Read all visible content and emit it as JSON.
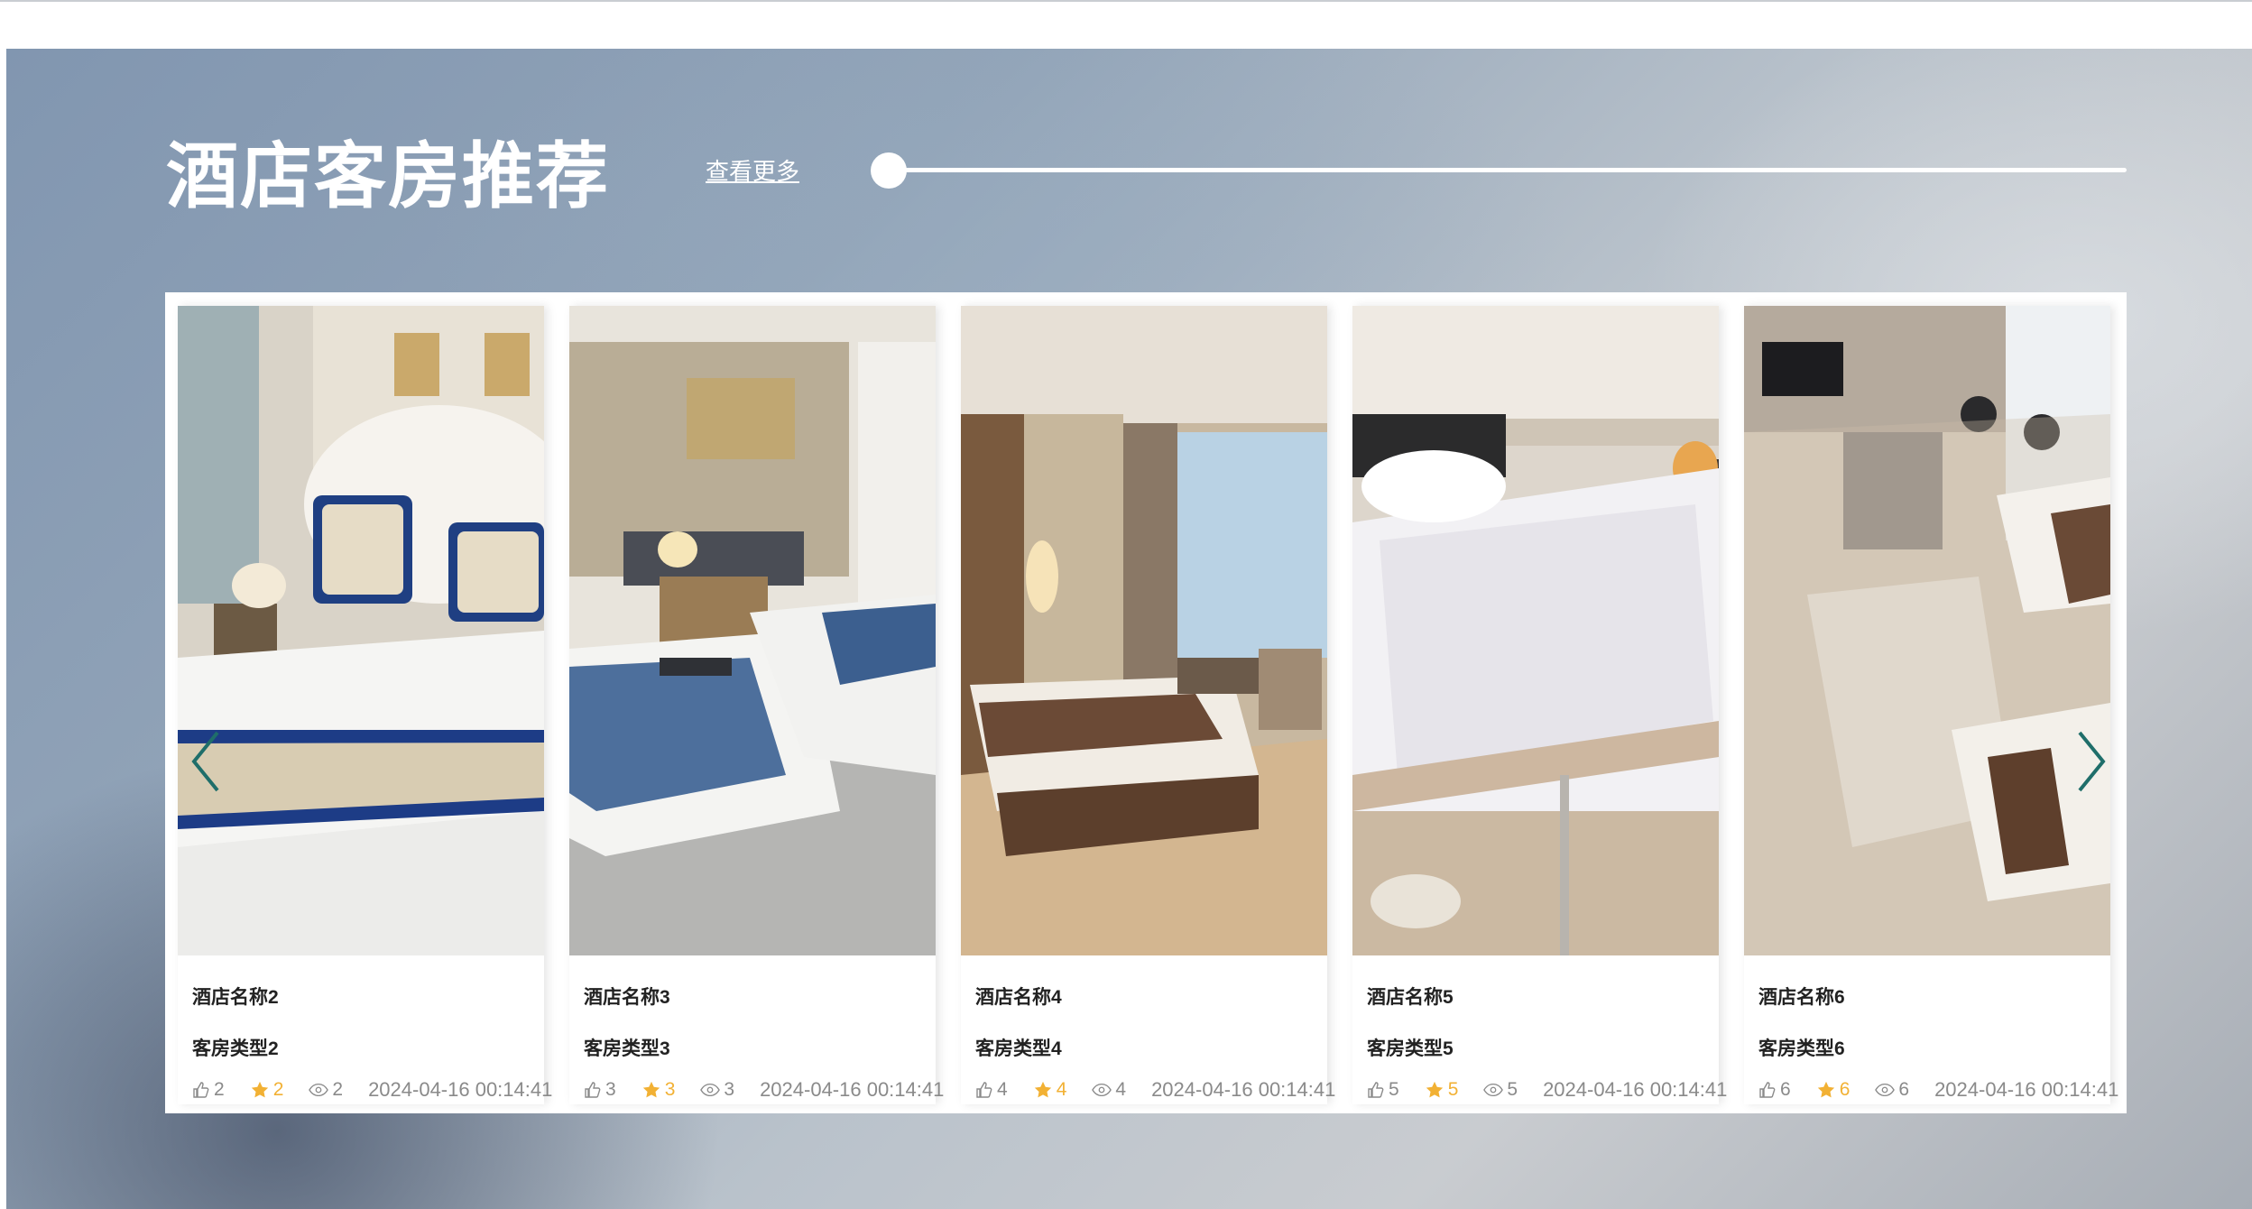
{
  "section": {
    "title": "酒店客房推荐",
    "more_label": "查看更多",
    "slider_value": 0
  },
  "carousel": {
    "prev_icon": "chevron-left-icon",
    "next_icon": "chevron-right-icon",
    "accent": "#1f6e6a",
    "cards": [
      {
        "name": "酒店名称2",
        "type": "客房类型2",
        "likes": "2",
        "stars": "2",
        "views": "2",
        "date": "2024-04-16 00:14:41",
        "image": "hotel-room-blue-pattern-bed"
      },
      {
        "name": "酒店名称3",
        "type": "客房类型3",
        "likes": "3",
        "stars": "3",
        "views": "3",
        "date": "2024-04-16 00:14:41",
        "image": "hotel-room-twin-beds-gray"
      },
      {
        "name": "酒店名称4",
        "type": "客房类型4",
        "likes": "4",
        "stars": "4",
        "views": "4",
        "date": "2024-04-16 00:14:41",
        "image": "hotel-room-brown-suite"
      },
      {
        "name": "酒店名称5",
        "type": "客房类型5",
        "likes": "5",
        "stars": "5",
        "views": "5",
        "date": "2024-04-16 00:14:41",
        "image": "mattress-topper-bed"
      },
      {
        "name": "酒店名称6",
        "type": "客房类型6",
        "likes": "6",
        "stars": "6",
        "views": "6",
        "date": "2024-04-16 00:14:41",
        "image": "hotel-room-overhead-twin"
      }
    ]
  }
}
